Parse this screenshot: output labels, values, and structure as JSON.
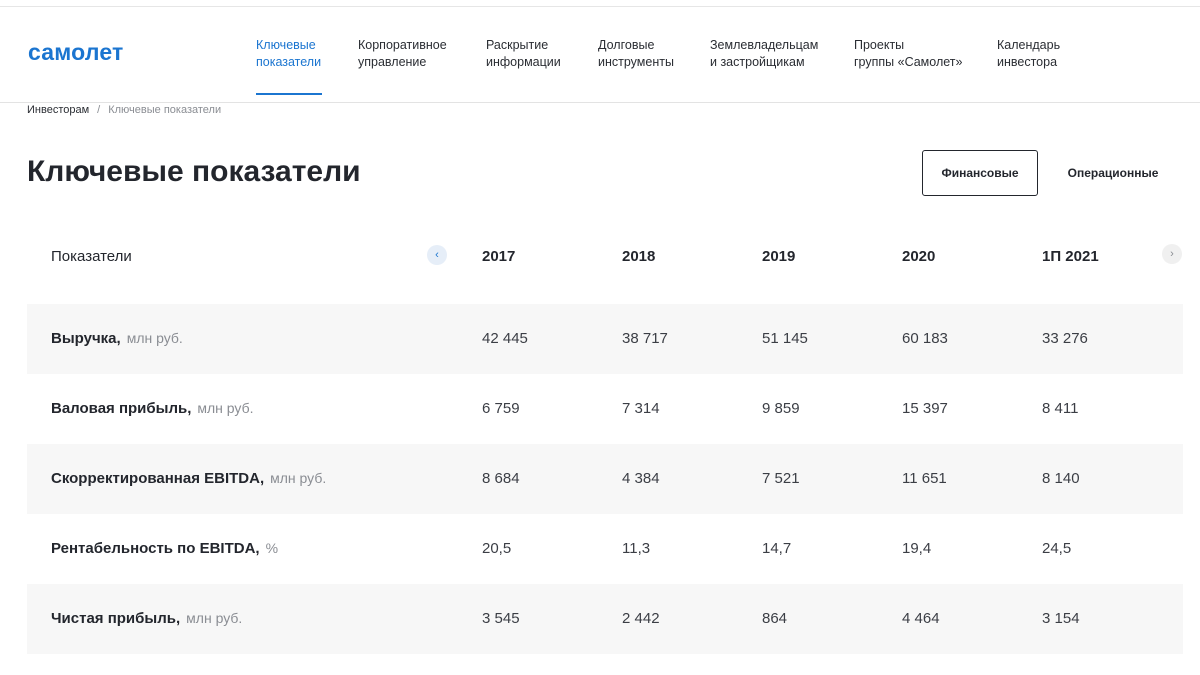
{
  "brand": {
    "logo_text": "самолет"
  },
  "nav": {
    "items": [
      {
        "label": "Ключевые\nпоказатели",
        "active": true
      },
      {
        "label": "Корпоративное\nуправление",
        "active": false
      },
      {
        "label": "Раскрытие\nинформации",
        "active": false
      },
      {
        "label": "Долговые\nинструменты",
        "active": false
      },
      {
        "label": "Землевладельцам\nи застройщикам",
        "active": false
      },
      {
        "label": "Проекты\nгруппы «Самолет»",
        "active": false
      },
      {
        "label": "Календарь\nинвестора",
        "active": false
      }
    ]
  },
  "breadcrumb": {
    "root": "Инвесторам",
    "separator": "/",
    "current": "Ключевые показатели"
  },
  "page": {
    "title": "Ключевые показатели"
  },
  "tabs": [
    {
      "label": "Финансовые",
      "selected": true
    },
    {
      "label": "Операционные",
      "selected": false
    }
  ],
  "table": {
    "header_label": "Показатели",
    "years": [
      "2017",
      "2018",
      "2019",
      "2020",
      "1П 2021"
    ],
    "rows": [
      {
        "label": "Выручка,",
        "unit": "млн руб.",
        "values": [
          "42 445",
          "38 717",
          "51 145",
          "60 183",
          "33 276"
        ]
      },
      {
        "label": "Валовая прибыль,",
        "unit": "млн руб.",
        "values": [
          "6 759",
          "7 314",
          "9 859",
          "15 397",
          "8 411"
        ]
      },
      {
        "label": "Скорректированная EBITDA,",
        "unit": "млн руб.",
        "values": [
          "8 684",
          "4 384",
          "7 521",
          "11 651",
          "8 140"
        ]
      },
      {
        "label": "Рентабельность по EBITDA,",
        "unit": "%",
        "values": [
          "20,5",
          "11,3",
          "14,7",
          "19,4",
          "24,5"
        ]
      },
      {
        "label": "Чистая прибыль,",
        "unit": "млн руб.",
        "values": [
          "3 545",
          "2 442",
          "864",
          "4 464",
          "3 154"
        ]
      }
    ]
  },
  "icons": {
    "prev": "chevron-left-icon",
    "next": "chevron-right-icon"
  },
  "colors": {
    "accent": "#1b75d0",
    "text": "#23262d",
    "muted": "#8a8d93",
    "row_shade": "#f7f7f7"
  }
}
